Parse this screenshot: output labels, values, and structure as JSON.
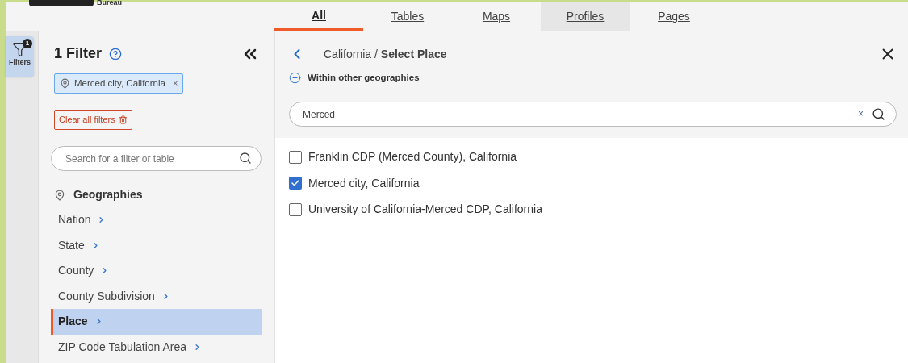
{
  "header": {
    "logo_text": "Bureau"
  },
  "tabs": [
    {
      "label": "All",
      "selected": true
    },
    {
      "label": "Tables",
      "selected": false
    },
    {
      "label": "Maps",
      "selected": false
    },
    {
      "label": "Profiles",
      "selected": false
    },
    {
      "label": "Pages",
      "selected": false
    }
  ],
  "rail": {
    "label": "Filters",
    "badge": "1"
  },
  "sidebar": {
    "title": "1 Filter",
    "chips": [
      {
        "label": "Merced city, California",
        "remove": "×"
      }
    ],
    "clear_button": "Clear all filters",
    "search": {
      "placeholder": "Search for a filter or table"
    },
    "section": "Geographies",
    "items": [
      {
        "label": "Nation",
        "selected": false
      },
      {
        "label": "State",
        "selected": false
      },
      {
        "label": "County",
        "selected": false
      },
      {
        "label": "County Subdivision",
        "selected": false
      },
      {
        "label": "Place",
        "selected": true
      },
      {
        "label": "ZIP Code Tabulation Area",
        "selected": false
      }
    ]
  },
  "panel": {
    "breadcrumb": "California / **Select Place**",
    "within_link": "Within other geographies",
    "search": {
      "value": "Merced",
      "clear": "×"
    },
    "results": [
      {
        "label": "Franklin CDP (Merced County), California",
        "checked": false
      },
      {
        "label": "Merced city, California",
        "checked": true
      },
      {
        "label": "University of California-Merced CDP, California",
        "checked": false
      }
    ]
  }
}
